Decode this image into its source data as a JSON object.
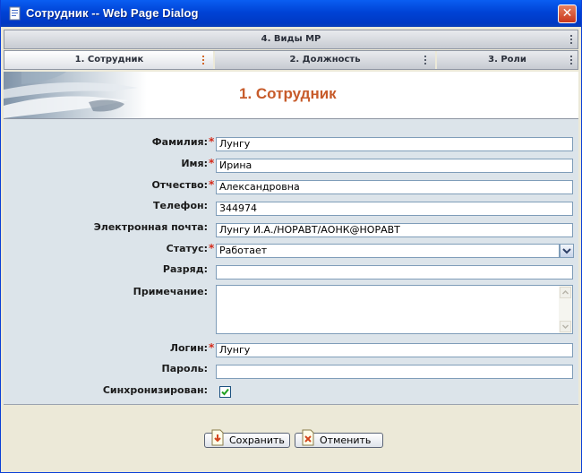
{
  "window": {
    "title": "Сотрудник -- Web Page Dialog",
    "close_glyph": "✕"
  },
  "tabs": {
    "top": {
      "label": "4. Виды МР"
    },
    "row": [
      {
        "label": "1. Сотрудник",
        "active": true
      },
      {
        "label": "2. Должность",
        "active": false
      },
      {
        "label": "3. Роли",
        "active": false
      }
    ]
  },
  "banner": {
    "heading": "1. Сотрудник"
  },
  "form": {
    "required_mark": "*",
    "fields": {
      "surname": {
        "label": "Фамилия:",
        "value": "Лунгу",
        "required": true
      },
      "name": {
        "label": "Имя:",
        "value": "Ирина",
        "required": true
      },
      "patronymic": {
        "label": "Отчество:",
        "value": "Александровна",
        "required": true
      },
      "phone": {
        "label": "Телефон:",
        "value": "344974",
        "required": false
      },
      "email": {
        "label": "Электронная почта:",
        "value": "Лунгу И.А./НОРАВТ/АОНК@НОРАВТ",
        "required": false
      },
      "status": {
        "label": "Статус:",
        "value": "Работает",
        "required": true
      },
      "grade": {
        "label": "Разряд:",
        "value": "",
        "required": false
      },
      "note": {
        "label": "Примечание:",
        "value": "",
        "required": false
      },
      "login": {
        "label": "Логин:",
        "value": "Лунгу",
        "required": true
      },
      "password": {
        "label": "Пароль:",
        "value": "",
        "required": false
      },
      "synced": {
        "label": "Синхронизирован:",
        "checked": true
      }
    }
  },
  "buttons": {
    "save": {
      "label": "Сохранить",
      "icon": "save-icon"
    },
    "cancel": {
      "label": "Отменить",
      "icon": "cancel-icon"
    }
  },
  "colors": {
    "heading": "#c75b2a",
    "required": "#d42a1a",
    "form_bg": "#dce4ea",
    "titlebar": "#0043d6"
  }
}
